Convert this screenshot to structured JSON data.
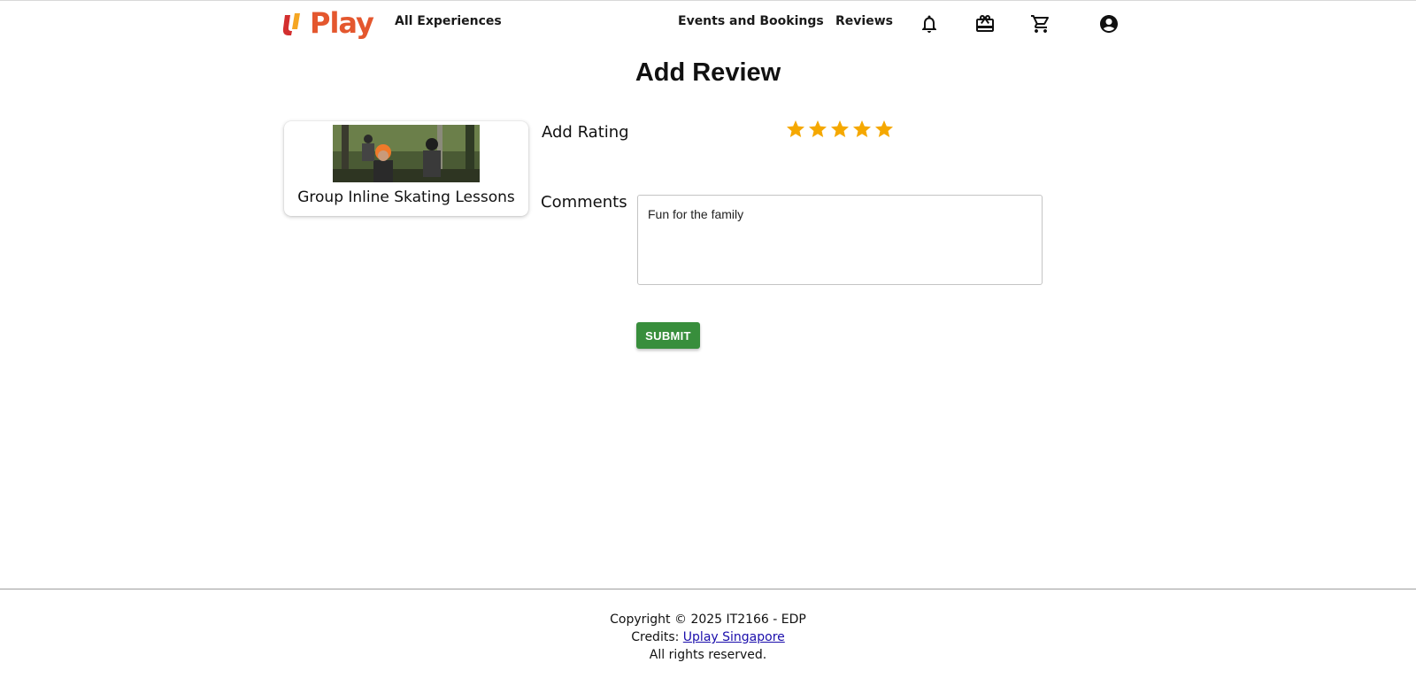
{
  "header": {
    "logo_text": "Play",
    "nav_all_experiences": "All Experiences",
    "nav_events_bookings": "Events and Bookings",
    "nav_reviews": "Reviews",
    "icons": [
      "bell-icon",
      "gift-card-icon",
      "cart-icon",
      "account-icon"
    ]
  },
  "page": {
    "title": "Add Review"
  },
  "experience": {
    "title": "Group Inline Skating Lessons"
  },
  "form": {
    "rating_label": "Add Rating",
    "rating_value": 5,
    "rating_max": 5,
    "comments_label": "Comments",
    "comments_value": "Fun for the family",
    "submit_label": "SUBMIT"
  },
  "footer": {
    "copyright": "Copyright © 2025 IT2166 - EDP",
    "credits_prefix": "Credits: ",
    "credits_link": "Uplay Singapore",
    "rights": "All rights reserved."
  },
  "colors": {
    "brand_orange": "#e4572e",
    "brand_red": "#d32f2f",
    "star": "#f5a800",
    "submit_green": "#388e3c",
    "link_blue": "#1a0dab"
  }
}
